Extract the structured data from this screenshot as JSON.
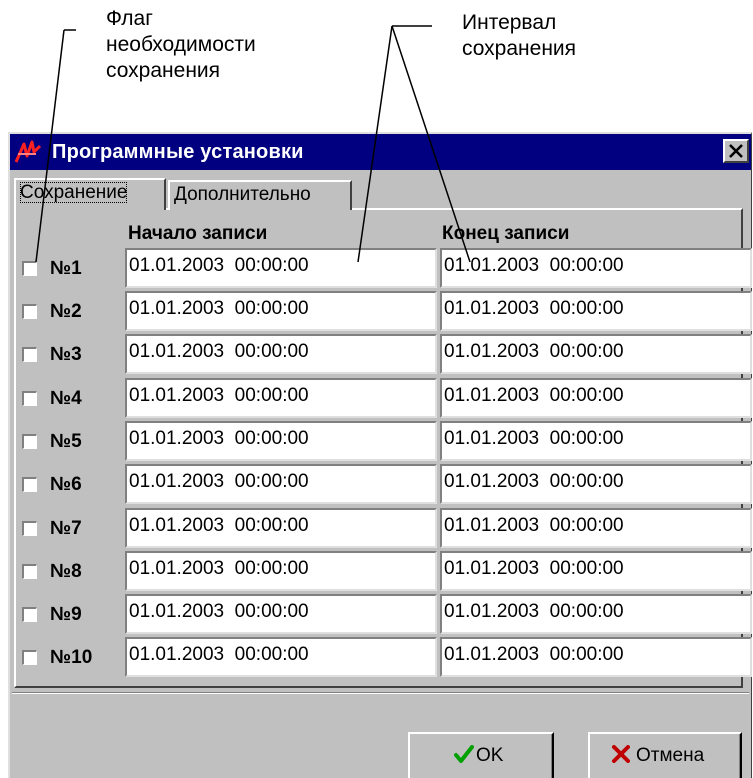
{
  "callouts": {
    "flag_line1": "Флаг",
    "flag_line2": "необходимости",
    "flag_line3": "сохранения",
    "interval_line1": "Интервал",
    "interval_line2": "сохранения"
  },
  "window": {
    "title": "Программные установки",
    "close_icon": "close-icon",
    "app_icon": "app-logo-icon",
    "accent_color": "#000080"
  },
  "tabs": [
    {
      "label": "Сохранение",
      "active": true
    },
    {
      "label": "Дополнительно",
      "active": false
    }
  ],
  "columns": {
    "start": "Начало записи",
    "end": "Конец записи"
  },
  "rows": [
    {
      "label": "№1",
      "checked": false,
      "start": "01.01.2003  00:00:00",
      "end": "01.01.2003  00:00:00"
    },
    {
      "label": "№2",
      "checked": false,
      "start": "01.01.2003  00:00:00",
      "end": "01.01.2003  00:00:00"
    },
    {
      "label": "№3",
      "checked": false,
      "start": "01.01.2003  00:00:00",
      "end": "01.01.2003  00:00:00"
    },
    {
      "label": "№4",
      "checked": false,
      "start": "01.01.2003  00:00:00",
      "end": "01.01.2003  00:00:00"
    },
    {
      "label": "№5",
      "checked": false,
      "start": "01.01.2003  00:00:00",
      "end": "01.01.2003  00:00:00"
    },
    {
      "label": "№6",
      "checked": false,
      "start": "01.01.2003  00:00:00",
      "end": "01.01.2003  00:00:00"
    },
    {
      "label": "№7",
      "checked": false,
      "start": "01.01.2003  00:00:00",
      "end": "01.01.2003  00:00:00"
    },
    {
      "label": "№8",
      "checked": false,
      "start": "01.01.2003  00:00:00",
      "end": "01.01.2003  00:00:00"
    },
    {
      "label": "№9",
      "checked": false,
      "start": "01.01.2003  00:00:00",
      "end": "01.01.2003  00:00:00"
    },
    {
      "label": "№10",
      "checked": false,
      "start": "01.01.2003  00:00:00",
      "end": "01.01.2003  00:00:00"
    }
  ],
  "buttons": {
    "ok": "OK",
    "ok_icon": "checkmark-icon",
    "ok_icon_color": "#00a000",
    "cancel": "Отмена",
    "cancel_icon": "cross-icon",
    "cancel_icon_color": "#c00000"
  }
}
